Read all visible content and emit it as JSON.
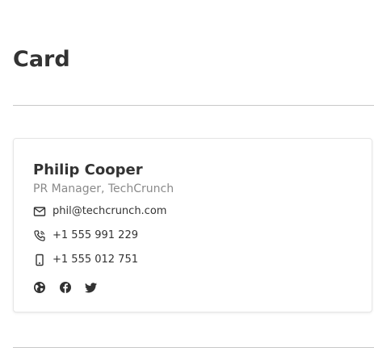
{
  "page": {
    "title": "Card"
  },
  "card": {
    "name": "Philip Cooper",
    "role": "PR Manager, TechCrunch",
    "email": "phil@techcrunch.com",
    "phone": "+1 555 991 229",
    "mobile": "+1 555 012 751",
    "contact_icons": [
      "mail-icon",
      "phone-icon",
      "mobile-icon"
    ],
    "social_icons": [
      "globe-icon",
      "facebook-icon",
      "twitter-icon"
    ]
  },
  "colors": {
    "text": "#333333",
    "muted": "#8a8a8a",
    "divider": "#c8c8c8",
    "card_border": "#e6e6e6"
  }
}
